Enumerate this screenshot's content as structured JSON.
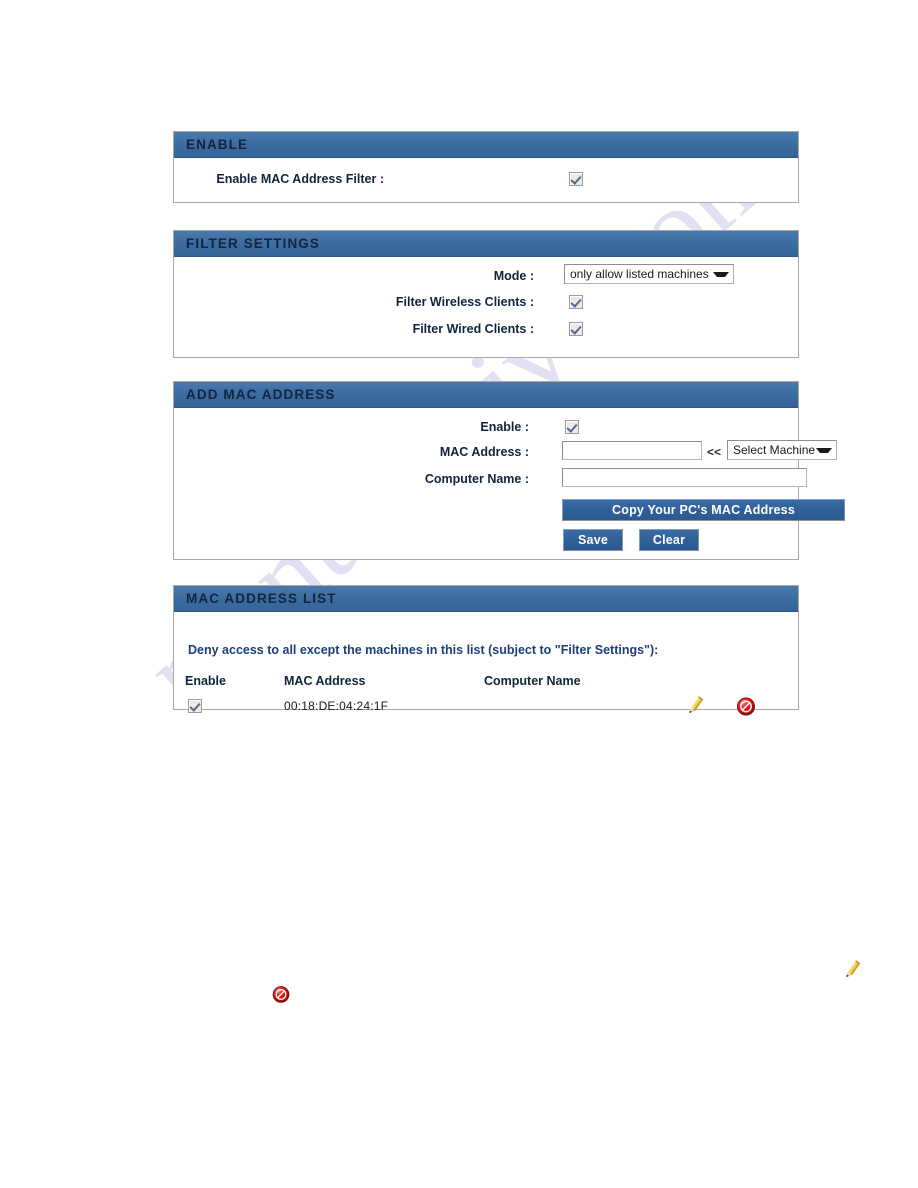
{
  "watermark": {
    "text": "manualshive.com"
  },
  "panels": {
    "enable": {
      "title": "ENABLE",
      "filter_label": "Enable MAC Address Filter :",
      "filter_checked": true
    },
    "filter_settings": {
      "title": "FILTER SETTINGS",
      "mode_label": "Mode :",
      "mode_value": "only allow listed machines",
      "mode_options": [
        "only allow listed machines"
      ],
      "wireless_label": "Filter Wireless Clients :",
      "wireless_checked": true,
      "wired_label": "Filter Wired Clients :",
      "wired_checked": true
    },
    "add_mac": {
      "title": "ADD MAC ADDRESS",
      "enable_label": "Enable :",
      "enable_checked": true,
      "mac_label": "MAC Address :",
      "mac_value": "",
      "mac_placeholder": "",
      "arrows": "<<",
      "select_machine_value": "Select Machine",
      "select_machine_options": [
        "Select Machine"
      ],
      "computer_label": "Computer Name :",
      "computer_value": "",
      "computer_placeholder": "",
      "copy_button": "Copy Your PC's MAC Address",
      "save_button": "Save",
      "clear_button": "Clear"
    },
    "mac_list": {
      "title": "MAC ADDRESS LIST",
      "note": "Deny access to all except the machines in this list (subject to \"Filter Settings\"):",
      "columns": [
        "Enable",
        "MAC Address",
        "Computer Name"
      ],
      "rows": [
        {
          "enabled": true,
          "mac_address": "00:18:DE:04:24:1F",
          "computer_name": "",
          "edit_icon": "pencil-icon",
          "delete_icon": "delete-icon"
        }
      ]
    }
  },
  "loose_icons": [
    {
      "name": "pencil-icon"
    },
    {
      "name": "delete-icon"
    }
  ],
  "colors": {
    "header_blue": "#3e6ea4",
    "button_blue": "#2f6099",
    "note_blue": "#1d3f79",
    "label_navy": "#12243d",
    "watermark": "#c9c9ea",
    "pencil_yellow": "#e8c63c",
    "delete_red": "#c81414"
  }
}
